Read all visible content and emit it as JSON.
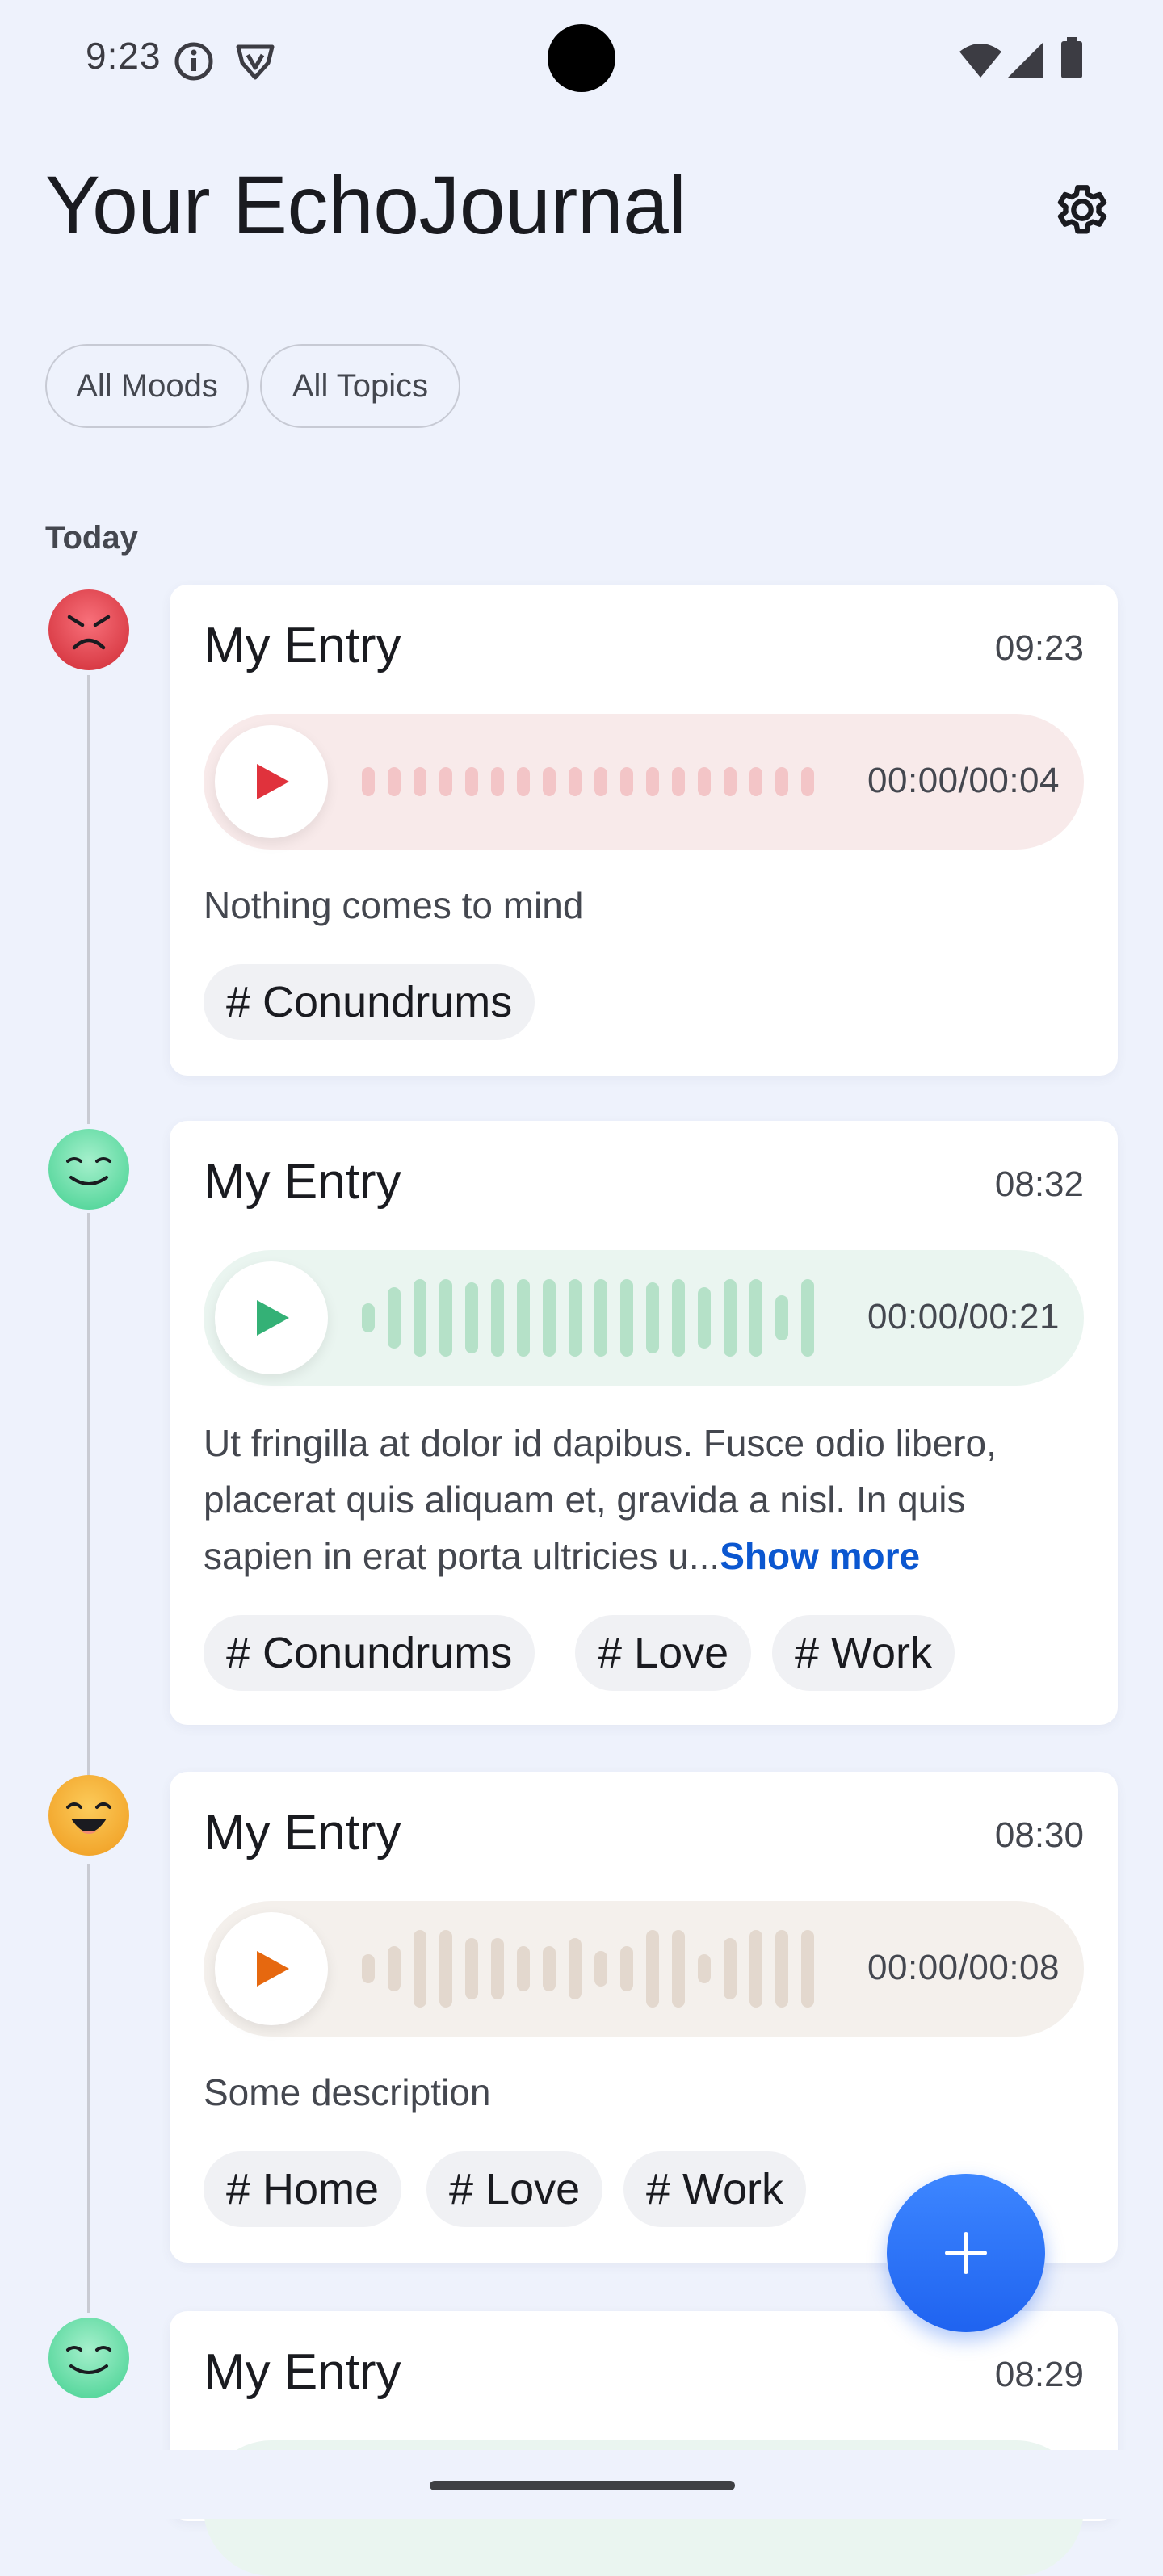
{
  "status_bar": {
    "time": "9:23",
    "icons": [
      "info-icon",
      "vpn-shield-icon",
      "wifi-icon",
      "signal-icon",
      "battery-icon"
    ]
  },
  "header": {
    "title": "Your EchoJournal",
    "settings_icon": "gear-icon"
  },
  "filters": {
    "moods_label": "All Moods",
    "topics_label": "All Topics"
  },
  "section": {
    "label": "Today"
  },
  "colors": {
    "accent": "#1F63F0",
    "show_more": "#0B57D0",
    "mood_stressed": "#E8454F",
    "mood_peaceful": "#5DDCA1",
    "mood_excited": "#F6B63A"
  },
  "entries": [
    {
      "mood": "stressed",
      "title": "My Entry",
      "time": "09:23",
      "duration": "00:00/00:04",
      "description": "Nothing comes to mind",
      "tags": [
        "# Conundrums"
      ]
    },
    {
      "mood": "peaceful",
      "title": "My Entry",
      "time": "08:32",
      "duration": "00:00/00:21",
      "description": "Ut fringilla at dolor id dapibus. Fusce odio libero, placerat quis aliquam et, gravida a nisl. In quis sapien in erat porta ultricies u...",
      "show_more": "Show more",
      "tags": [
        "# Conundrums",
        "# Love",
        "# Work"
      ]
    },
    {
      "mood": "excited",
      "title": "My Entry",
      "time": "08:30",
      "duration": "00:00/00:08",
      "description": "Some description",
      "tags": [
        "# Home",
        "# Love",
        "# Work"
      ]
    },
    {
      "mood": "peaceful",
      "title": "My Entry",
      "time": "08:29"
    }
  ],
  "fab": {
    "icon": "plus-icon"
  }
}
